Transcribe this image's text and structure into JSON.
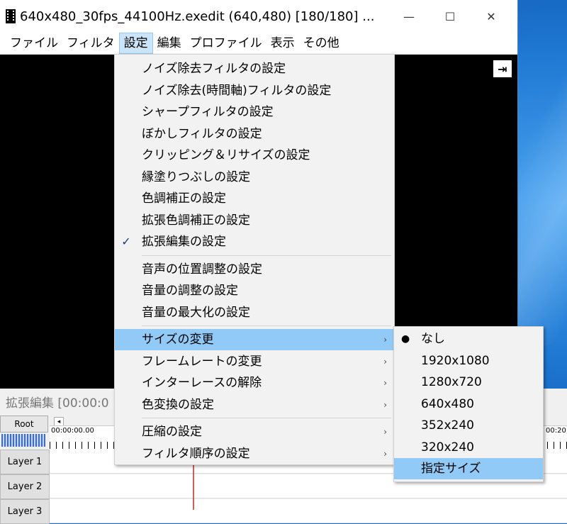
{
  "window": {
    "title": "640x480_30fps_44100Hz.exedit (640,480)  [180/180] ...",
    "minimize": "—",
    "maximize": "☐",
    "close": "✕"
  },
  "menubar": [
    "ファイル",
    "フィルタ",
    "設定",
    "編集",
    "プロファイル",
    "表示",
    "その他"
  ],
  "settings_menu": {
    "group1": [
      {
        "label": "ノイズ除去フィルタの設定",
        "checked": false
      },
      {
        "label": "ノイズ除去(時間軸)フィルタの設定",
        "checked": false
      },
      {
        "label": "シャープフィルタの設定",
        "checked": false
      },
      {
        "label": "ぼかしフィルタの設定",
        "checked": false
      },
      {
        "label": "クリッピング＆リサイズの設定",
        "checked": false
      },
      {
        "label": "縁塗りつぶしの設定",
        "checked": false
      },
      {
        "label": "色調補正の設定",
        "checked": false
      },
      {
        "label": "拡張色調補正の設定",
        "checked": false
      },
      {
        "label": "拡張編集の設定",
        "checked": true
      }
    ],
    "group2": [
      {
        "label": "音声の位置調整の設定"
      },
      {
        "label": "音量の調整の設定"
      },
      {
        "label": "音量の最大化の設定"
      }
    ],
    "group3": [
      {
        "label": "サイズの変更",
        "submenu": true,
        "highlighted": true
      },
      {
        "label": "フレームレートの変更",
        "submenu": true
      },
      {
        "label": "インターレースの解除",
        "submenu": true
      },
      {
        "label": "色変換の設定",
        "submenu": true
      }
    ],
    "group4": [
      {
        "label": "圧縮の設定",
        "submenu": true
      },
      {
        "label": "フィルタ順序の設定",
        "submenu": true
      }
    ],
    "check_glyph": "✓",
    "arrow_glyph": "›"
  },
  "size_submenu": {
    "items": [
      {
        "label": "なし",
        "selected": true
      },
      {
        "label": "1920x1080"
      },
      {
        "label": "1280x720"
      },
      {
        "label": "640x480"
      },
      {
        "label": "352x240"
      },
      {
        "label": "320x240"
      },
      {
        "label": "指定サイズ",
        "highlighted": true
      }
    ],
    "bullet_glyph": "●"
  },
  "timeline": {
    "title": "拡張編集 [00:00:0",
    "root_label": "Root",
    "time_start": "00:00:00.00",
    "time_right": "00:20.",
    "layers": [
      "Layer 1",
      "Layer 2",
      "Layer 3"
    ]
  },
  "preview": {
    "expand_glyph": "⇥"
  }
}
